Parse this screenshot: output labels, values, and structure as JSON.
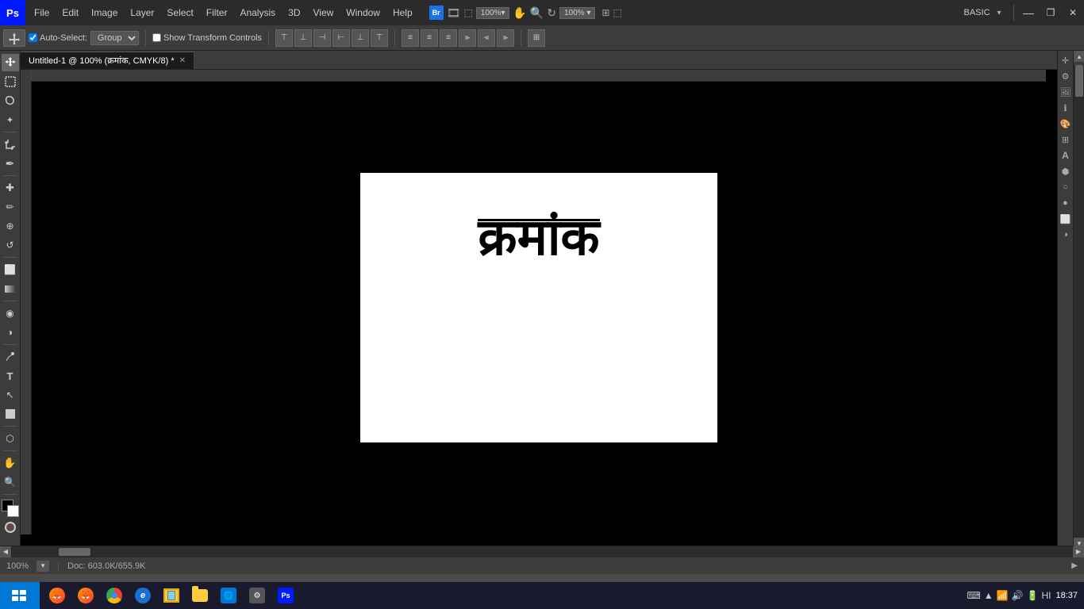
{
  "app": {
    "name": "Ps",
    "title": "BASIC",
    "document_title": "Untitled-1 @ 100% (क्रमांक, CMYK/8) *"
  },
  "titlebar": {
    "menus": [
      "File",
      "Edit",
      "Image",
      "Layer",
      "Select",
      "Filter",
      "Analysis",
      "3D",
      "View",
      "Window",
      "Help"
    ],
    "select_label": "Select",
    "mode_badge": "BASIC",
    "win_minimize": "—",
    "win_restore": "❐",
    "win_close": "✕"
  },
  "toolbar_icons": [
    {
      "name": "move-tool",
      "symbol": "✛"
    },
    {
      "name": "marquee-tool",
      "symbol": "⬚"
    },
    {
      "name": "lasso-tool",
      "symbol": "⌾"
    },
    {
      "name": "magic-wand-tool",
      "symbol": "⚡"
    },
    {
      "name": "crop-tool",
      "symbol": "⊞"
    },
    {
      "name": "eyedropper-tool",
      "symbol": "✒"
    },
    {
      "name": "healing-tool",
      "symbol": "✚"
    },
    {
      "name": "brush-tool",
      "symbol": "✏"
    },
    {
      "name": "clone-stamp-tool",
      "symbol": "⊕"
    },
    {
      "name": "history-brush-tool",
      "symbol": "↺"
    },
    {
      "name": "eraser-tool",
      "symbol": "⬜"
    },
    {
      "name": "gradient-tool",
      "symbol": "◫"
    },
    {
      "name": "blur-tool",
      "symbol": "◉"
    },
    {
      "name": "dodge-tool",
      "symbol": "◑"
    },
    {
      "name": "pen-tool",
      "symbol": "✒"
    },
    {
      "name": "text-tool",
      "symbol": "T"
    },
    {
      "name": "path-selection-tool",
      "symbol": "↖"
    },
    {
      "name": "shape-tool",
      "symbol": "■"
    },
    {
      "name": "3d-tool",
      "symbol": "⬡"
    },
    {
      "name": "hand-tool",
      "symbol": "✋"
    },
    {
      "name": "zoom-tool",
      "symbol": "🔍"
    },
    {
      "name": "foreground-color",
      "symbol": "■"
    },
    {
      "name": "background-color",
      "symbol": "□"
    },
    {
      "name": "quick-mask-tool",
      "symbol": "○"
    }
  ],
  "options_bar": {
    "auto_select_label": "Auto-Select:",
    "group_label": "Group",
    "show_transform_label": "Show Transform Controls"
  },
  "canvas": {
    "tab_label": "Untitled-1 @ 100% (क्रमांक, CMYK/8) *",
    "canvas_text": "क्रमांक",
    "zoom": "100%"
  },
  "statusbar": {
    "zoom": "100%",
    "doc_info": "Doc: 603.0K/655.9K"
  },
  "taskbar": {
    "start_label": "start",
    "time": "18:37",
    "icons": [
      "firefox",
      "chrome",
      "ie",
      "explorer",
      "folder",
      "taskbar6",
      "taskbar7",
      "ps"
    ]
  },
  "right_panel_icons": [
    {
      "name": "navigator-icon",
      "symbol": "✛"
    },
    {
      "name": "properties-icon",
      "symbol": "⚙"
    },
    {
      "name": "image-icon",
      "symbol": "🖼"
    },
    {
      "name": "info-icon",
      "symbol": "ℹ"
    },
    {
      "name": "color-swatches-icon",
      "symbol": "🎨"
    },
    {
      "name": "table-icon",
      "symbol": "⊞"
    },
    {
      "name": "character-icon",
      "symbol": "A"
    },
    {
      "name": "transform-icon",
      "symbol": "⬢"
    },
    {
      "name": "stroke-icon",
      "symbol": "○"
    },
    {
      "name": "circle-icon",
      "symbol": "●"
    },
    {
      "name": "layers-icon",
      "symbol": "⬜"
    },
    {
      "name": "adjust-icon",
      "symbol": "◑"
    }
  ]
}
